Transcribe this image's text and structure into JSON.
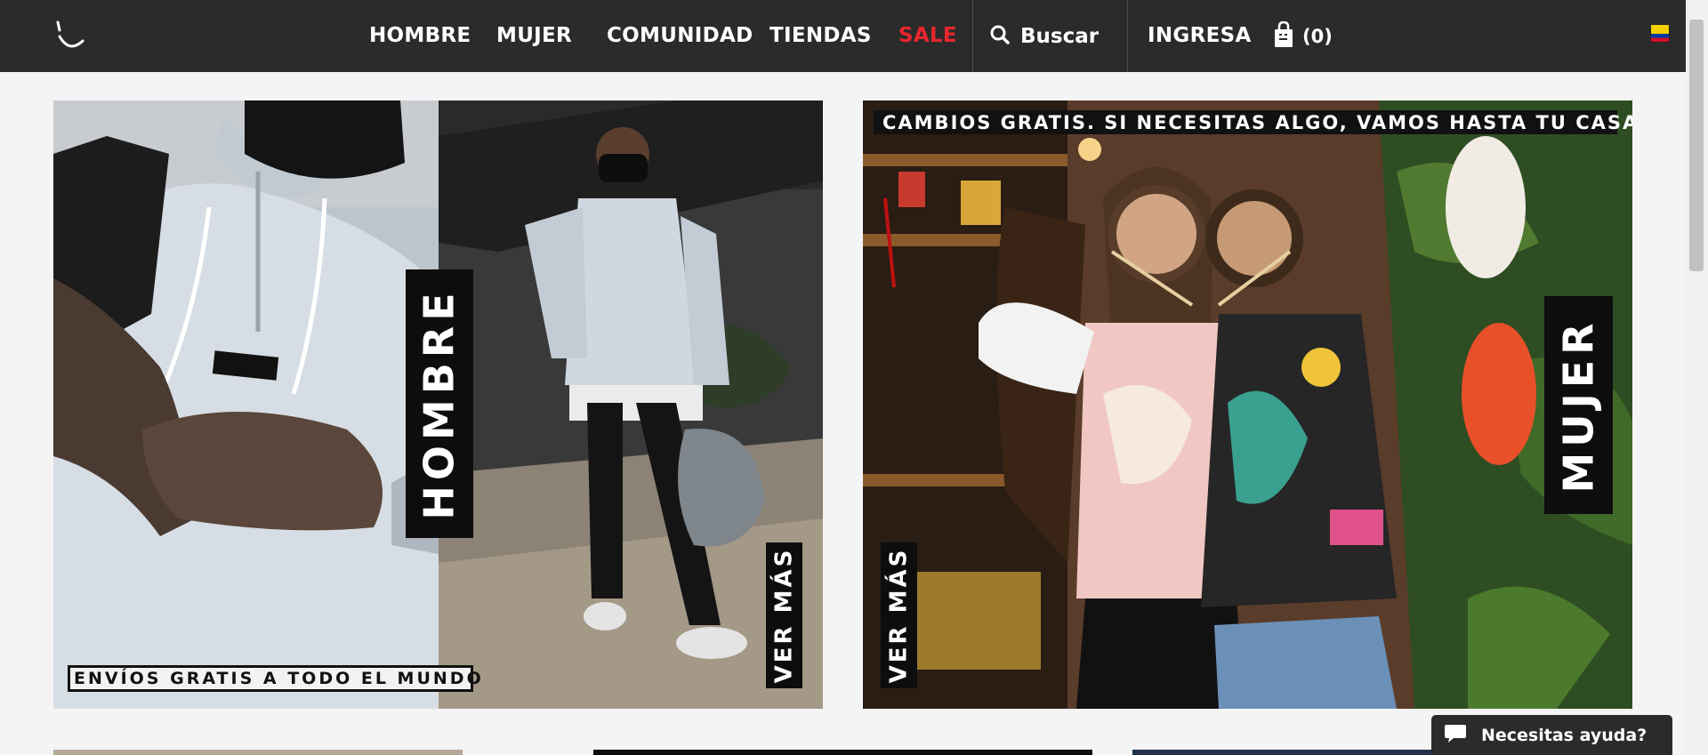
{
  "header": {
    "nav": [
      "HOMBRE",
      "MUJER",
      "COMUNIDAD",
      "TIENDAS",
      "SALE"
    ],
    "search_label": "Buscar",
    "login_label": "INGRESA",
    "cart_count": "(0)",
    "flag_icon": "colombia-flag-icon",
    "colors": {
      "background": "#2b2b2b",
      "sale": "#e8262d"
    }
  },
  "banners": {
    "men": {
      "label": "HOMBRE",
      "cta": "VER MÁS",
      "shipping_text": "ENVÍOS GRATIS A TODO EL MUNDO"
    },
    "women": {
      "label": "MUJER",
      "cta": "VER MÁS",
      "returns_text": "CAMBIOS GRATIS. SI NECESITAS ALGO, VAMOS HASTA TU CASA"
    }
  },
  "help": {
    "label": "Necesitas ayuda?"
  }
}
